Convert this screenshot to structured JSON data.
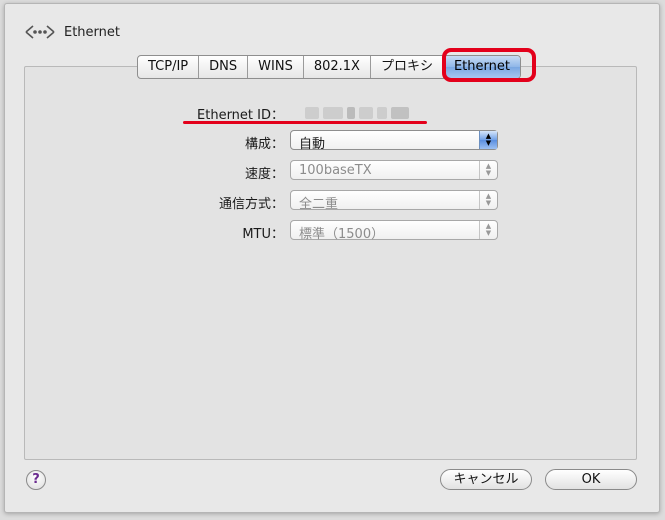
{
  "window": {
    "title": "Ethernet"
  },
  "tabs": [
    {
      "label": "TCP/IP",
      "active": false
    },
    {
      "label": "DNS",
      "active": false
    },
    {
      "label": "WINS",
      "active": false
    },
    {
      "label": "802.1X",
      "active": false
    },
    {
      "label": "プロキシ",
      "active": false
    },
    {
      "label": "Ethernet",
      "active": true
    }
  ],
  "form": {
    "ethernet_id_label": "Ethernet ID：",
    "config_label": "構成：",
    "config_value": "自動",
    "speed_label": "速度：",
    "speed_value": "100baseTX",
    "duplex_label": "通信方式：",
    "duplex_value": "全二重",
    "mtu_label": "MTU：",
    "mtu_value": "標準（1500）"
  },
  "buttons": {
    "help": "?",
    "cancel": "キャンセル",
    "ok": "OK"
  },
  "colors": {
    "annotation": "#e3001b",
    "selected_tab": "#8fb6e8"
  }
}
